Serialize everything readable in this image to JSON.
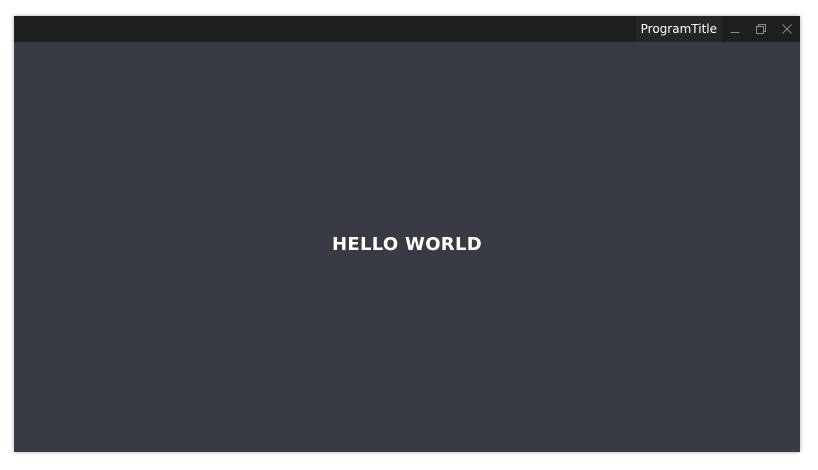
{
  "window": {
    "title": "ProgramTitle",
    "controls": {
      "minimize_icon": "minimize-icon",
      "restore_icon": "restore-icon",
      "close_icon": "close-icon"
    }
  },
  "main": {
    "heading": "HELLO WORLD"
  },
  "colors": {
    "title_bar": "#1f1f1f",
    "title_label_bg": "#262626",
    "content_bg": "#393b44",
    "text": "#ffffff",
    "control_icon": "#8a8a8a"
  }
}
